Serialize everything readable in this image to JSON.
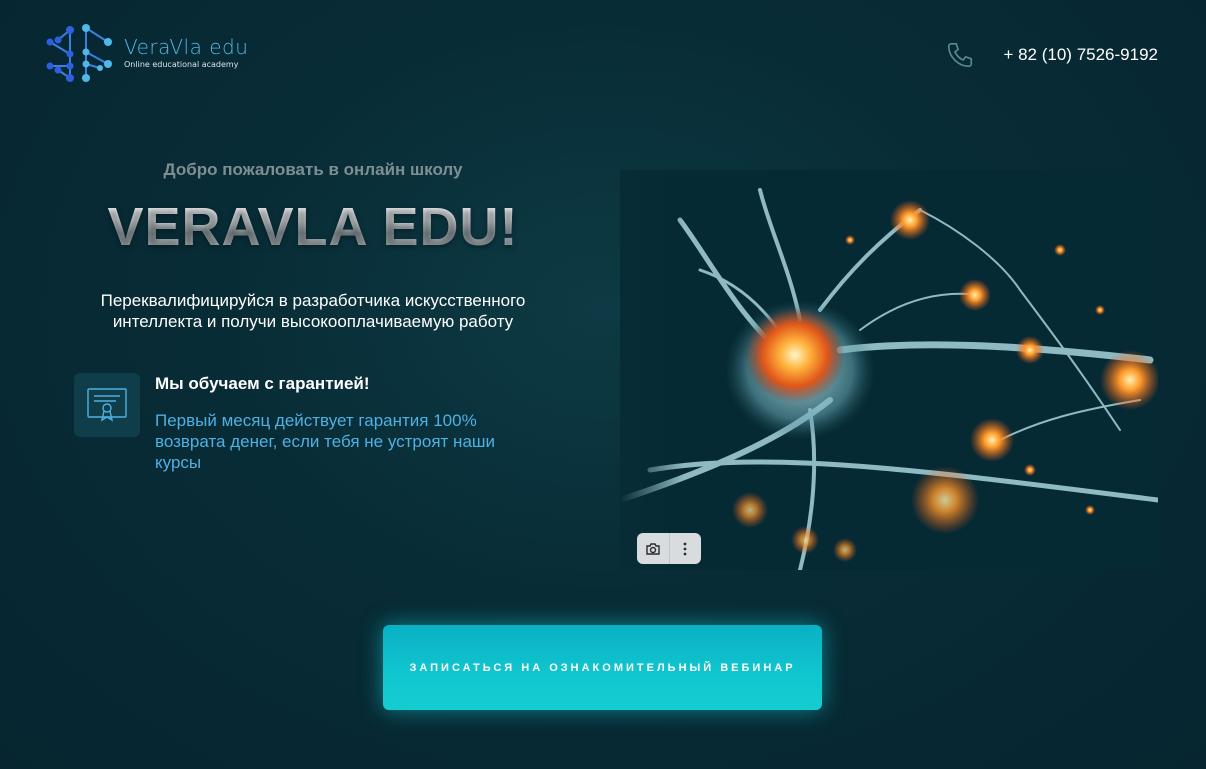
{
  "header": {
    "logo_name": "VeraVla edu",
    "logo_tagline": "Online educational academy",
    "phone_icon": "phone-icon",
    "phone_number": "+ 82 (10) 7526-9192"
  },
  "hero": {
    "welcome": "Добро пожаловать в онлайн школу",
    "title": "VERAVLA EDU!",
    "subtitle": "Переквалифицируйся в разработчика искусственного интеллекта и получи высокооплачиваемую работу"
  },
  "guarantee": {
    "icon": "certificate-icon",
    "title": "Мы обучаем с гарантией!",
    "text": "Первый месяц действует гарантия 100% возврата денег, если тебя не устроят наши курсы"
  },
  "image_toolbar": {
    "icons": [
      "camera-icon",
      "more-vertical-icon"
    ]
  },
  "cta": {
    "label": "ЗАПИСАТЬСЯ НА ОЗНАКОМИТЕЛЬНЫЙ ВЕБИНАР"
  },
  "colors": {
    "background": "#082c36",
    "accent_blue": "#4fb0e2",
    "cta_teal": "#10c7cf"
  }
}
